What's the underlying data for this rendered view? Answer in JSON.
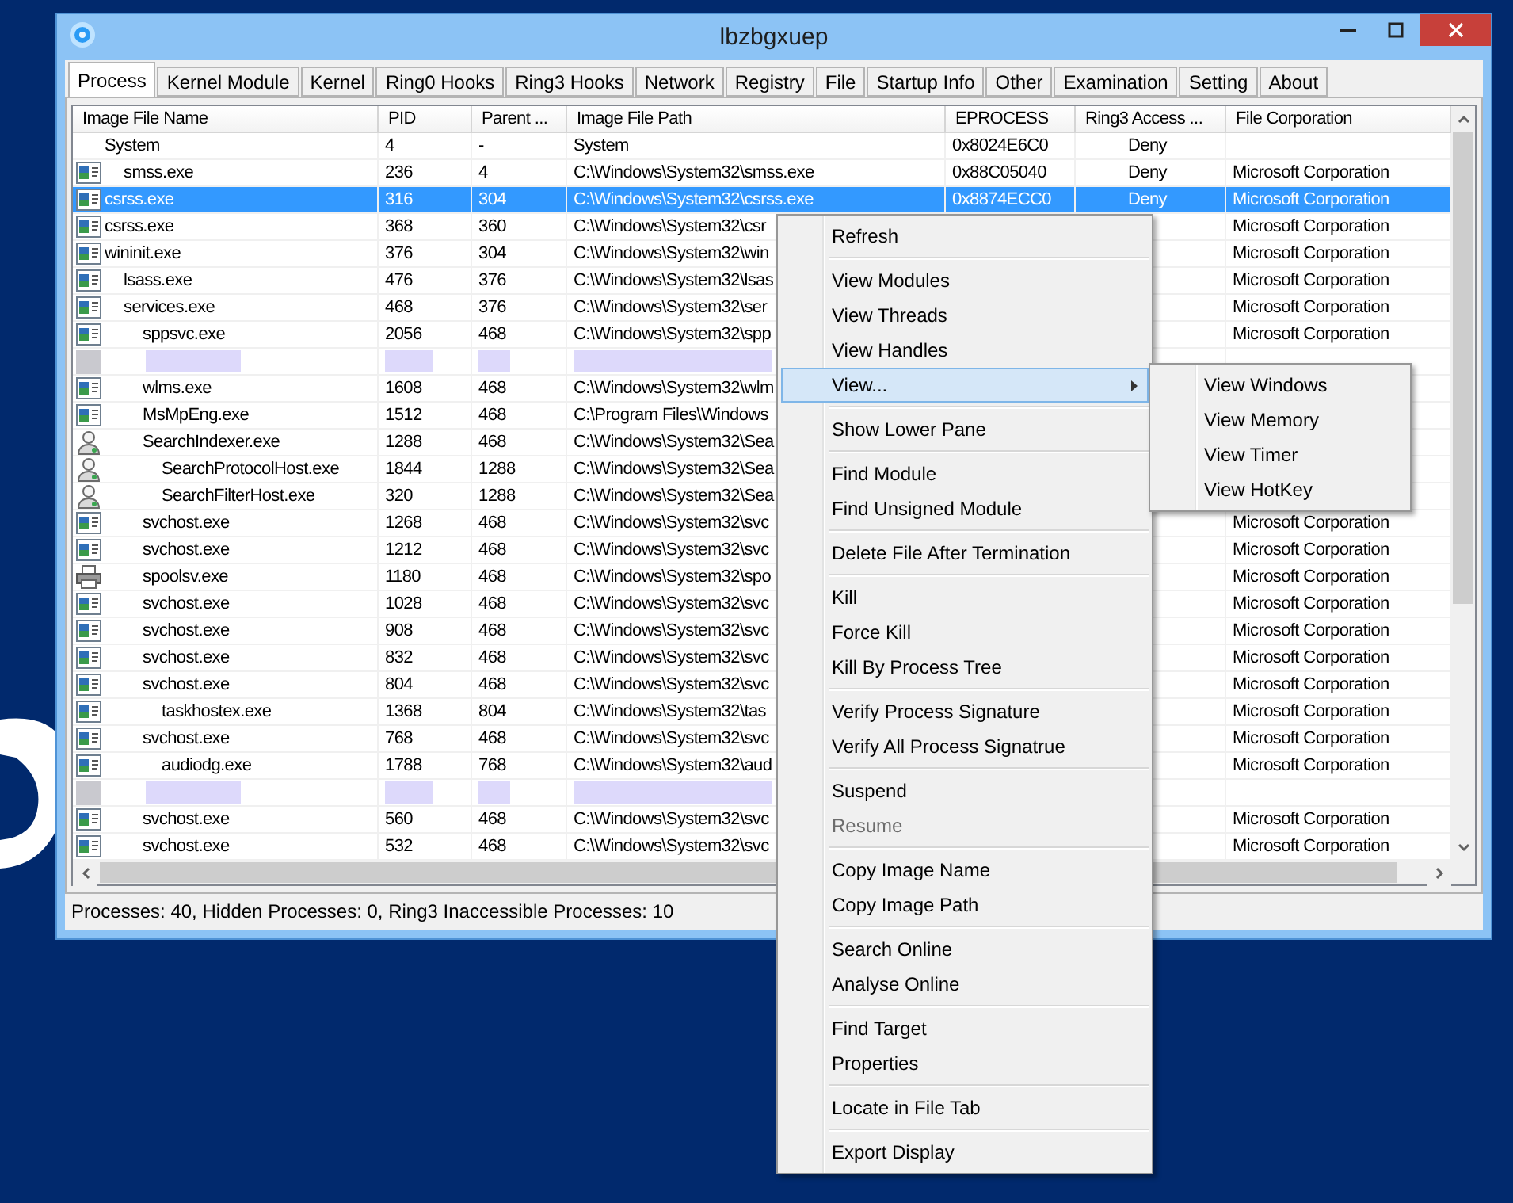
{
  "window": {
    "title": "lbzbgxuep"
  },
  "tabs": [
    {
      "label": "Process",
      "selected": true
    },
    {
      "label": "Kernel Module",
      "selected": false
    },
    {
      "label": "Kernel",
      "selected": false
    },
    {
      "label": "Ring0 Hooks",
      "selected": false
    },
    {
      "label": "Ring3 Hooks",
      "selected": false
    },
    {
      "label": "Network",
      "selected": false
    },
    {
      "label": "Registry",
      "selected": false
    },
    {
      "label": "File",
      "selected": false
    },
    {
      "label": "Startup Info",
      "selected": false
    },
    {
      "label": "Other",
      "selected": false
    },
    {
      "label": "Examination",
      "selected": false
    },
    {
      "label": "Setting",
      "selected": false
    },
    {
      "label": "About",
      "selected": false
    }
  ],
  "table": {
    "columns": [
      "Image File Name",
      "PID",
      "Parent ...",
      "Image File Path",
      "EPROCESS",
      "Ring3 Access ...",
      "File Corporation"
    ],
    "processes": [
      {
        "kind": "system",
        "name": "System",
        "pid": "4",
        "parent": "-",
        "path": "System",
        "eprocess": "0x8024E6C0",
        "access": "Deny",
        "selected": false,
        "children": [
          {
            "kind": "app",
            "name": "smss.exe",
            "pid": "236",
            "parent": "4",
            "path": "C:\\Windows\\System32\\smss.exe",
            "eprocess": "0x88C05040",
            "access": "Deny",
            "corp": "Microsoft Corporation",
            "selected": false
          }
        ]
      },
      {
        "kind": "app",
        "name": "csrss.exe",
        "pid": "316",
        "parent": "304",
        "path": "C:\\Windows\\System32\\csrss.exe",
        "eprocess": "0x8874ECC0",
        "access": "Deny",
        "corp": "Microsoft Corporation",
        "selected": true
      },
      {
        "kind": "app",
        "name": "csrss.exe",
        "pid": "368",
        "parent": "360",
        "path": "C:\\Windows\\System32\\csr",
        "corp": "Microsoft Corporation",
        "selected": false
      },
      {
        "kind": "app",
        "name": "wininit.exe",
        "pid": "376",
        "parent": "304",
        "path": "C:\\Windows\\System32\\win",
        "corp": "Microsoft Corporation",
        "selected": false,
        "children": [
          {
            "kind": "app",
            "name": "lsass.exe",
            "pid": "476",
            "parent": "376",
            "path": "C:\\Windows\\System32\\lsas",
            "corp": "Microsoft Corporation",
            "selected": false
          },
          {
            "kind": "app",
            "name": "services.exe",
            "pid": "468",
            "parent": "376",
            "path": "C:\\Windows\\System32\\ser",
            "corp": "Microsoft Corporation",
            "selected": false,
            "children": [
              {
                "kind": "app",
                "name": "sppsvc.exe",
                "pid": "2056",
                "parent": "468",
                "path": "C:\\Windows\\System32\\spp",
                "corp": "Microsoft Corporation",
                "selected": false
              },
              {
                "kind": "redacted",
                "selected": false
              },
              {
                "kind": "app",
                "name": "wlms.exe",
                "pid": "1608",
                "parent": "468",
                "path": "C:\\Windows\\System32\\wlm",
                "selected": false
              },
              {
                "kind": "app",
                "name": "MsMpEng.exe",
                "pid": "1512",
                "parent": "468",
                "path": "C:\\Program Files\\Windows",
                "selected": false
              },
              {
                "kind": "search",
                "name": "SearchIndexer.exe",
                "pid": "1288",
                "parent": "468",
                "path": "C:\\Windows\\System32\\Sea",
                "selected": false,
                "children": [
                  {
                    "kind": "search",
                    "name": "SearchProtocolHost.exe",
                    "pid": "1844",
                    "parent": "1288",
                    "path": "C:\\Windows\\System32\\Sea",
                    "selected": false
                  },
                  {
                    "kind": "search",
                    "name": "SearchFilterHost.exe",
                    "pid": "320",
                    "parent": "1288",
                    "path": "C:\\Windows\\System32\\Sea",
                    "selected": false
                  }
                ]
              },
              {
                "kind": "app",
                "name": "svchost.exe",
                "pid": "1268",
                "parent": "468",
                "path": "C:\\Windows\\System32\\svc",
                "corp": "Microsoft Corporation",
                "selected": false
              },
              {
                "kind": "app",
                "name": "svchost.exe",
                "pid": "1212",
                "parent": "468",
                "path": "C:\\Windows\\System32\\svc",
                "corp": "Microsoft Corporation",
                "selected": false
              },
              {
                "kind": "printer",
                "name": "spoolsv.exe",
                "pid": "1180",
                "parent": "468",
                "path": "C:\\Windows\\System32\\spo",
                "corp": "Microsoft Corporation",
                "selected": false
              },
              {
                "kind": "app",
                "name": "svchost.exe",
                "pid": "1028",
                "parent": "468",
                "path": "C:\\Windows\\System32\\svc",
                "corp": "Microsoft Corporation",
                "selected": false
              },
              {
                "kind": "app",
                "name": "svchost.exe",
                "pid": "908",
                "parent": "468",
                "path": "C:\\Windows\\System32\\svc",
                "corp": "Microsoft Corporation",
                "selected": false
              },
              {
                "kind": "app",
                "name": "svchost.exe",
                "pid": "832",
                "parent": "468",
                "path": "C:\\Windows\\System32\\svc",
                "corp": "Microsoft Corporation",
                "selected": false
              },
              {
                "kind": "app",
                "name": "svchost.exe",
                "pid": "804",
                "parent": "468",
                "path": "C:\\Windows\\System32\\svc",
                "corp": "Microsoft Corporation",
                "selected": false,
                "children": [
                  {
                    "kind": "app",
                    "name": "taskhostex.exe",
                    "pid": "1368",
                    "parent": "804",
                    "path": "C:\\Windows\\System32\\tas",
                    "corp": "Microsoft Corporation",
                    "selected": false
                  }
                ]
              },
              {
                "kind": "app",
                "name": "svchost.exe",
                "pid": "768",
                "parent": "468",
                "path": "C:\\Windows\\System32\\svc",
                "corp": "Microsoft Corporation",
                "selected": false,
                "children": [
                  {
                    "kind": "app",
                    "name": "audiodg.exe",
                    "pid": "1788",
                    "parent": "768",
                    "path": "C:\\Windows\\System32\\aud",
                    "corp": "Microsoft Corporation",
                    "selected": false
                  }
                ]
              },
              {
                "kind": "redacted",
                "selected": false
              },
              {
                "kind": "app",
                "name": "svchost.exe",
                "pid": "560",
                "parent": "468",
                "path": "C:\\Windows\\System32\\svc",
                "corp": "Microsoft Corporation",
                "selected": false
              },
              {
                "kind": "app",
                "name": "svchost.exe",
                "pid": "532",
                "parent": "468",
                "path": "C:\\Windows\\System32\\svc",
                "corp": "Microsoft Corporation",
                "selected": false
              }
            ]
          }
        ]
      }
    ]
  },
  "status_bar": "Processes: 40, Hidden Processes: 0, Ring3 Inaccessible Processes: 10",
  "context_menu": {
    "groups": [
      [
        {
          "label": "Refresh",
          "kind": "action",
          "selected": false,
          "disabled": false
        }
      ],
      [
        {
          "label": "View Modules",
          "kind": "action",
          "selected": false,
          "disabled": false
        },
        {
          "label": "View Threads",
          "kind": "action",
          "selected": false,
          "disabled": false
        },
        {
          "label": "View Handles",
          "kind": "action",
          "selected": false,
          "disabled": false
        },
        {
          "label": "View...",
          "kind": "submenu",
          "selected": true,
          "disabled": false
        }
      ],
      [
        {
          "label": "Show Lower Pane",
          "kind": "action",
          "selected": false,
          "disabled": false
        }
      ],
      [
        {
          "label": "Find Module",
          "kind": "action",
          "selected": false,
          "disabled": false
        },
        {
          "label": "Find Unsigned Module",
          "kind": "action",
          "selected": false,
          "disabled": false
        }
      ],
      [
        {
          "label": "Delete File After Termination",
          "kind": "action",
          "selected": false,
          "disabled": false
        }
      ],
      [
        {
          "label": "Kill",
          "kind": "action",
          "selected": false,
          "disabled": false
        },
        {
          "label": "Force Kill",
          "kind": "action",
          "selected": false,
          "disabled": false
        },
        {
          "label": "Kill By Process Tree",
          "kind": "action",
          "selected": false,
          "disabled": false
        }
      ],
      [
        {
          "label": "Verify Process Signature",
          "kind": "action",
          "selected": false,
          "disabled": false
        },
        {
          "label": "Verify All Process Signatrue",
          "kind": "action",
          "selected": false,
          "disabled": false
        }
      ],
      [
        {
          "label": "Suspend",
          "kind": "action",
          "selected": false,
          "disabled": false
        },
        {
          "label": "Resume",
          "kind": "action",
          "selected": false,
          "disabled": true
        }
      ],
      [
        {
          "label": "Copy Image Name",
          "kind": "action",
          "selected": false,
          "disabled": false
        },
        {
          "label": "Copy Image Path",
          "kind": "action",
          "selected": false,
          "disabled": false
        }
      ],
      [
        {
          "label": "Search Online",
          "kind": "action",
          "selected": false,
          "disabled": false
        },
        {
          "label": "Analyse Online",
          "kind": "action",
          "selected": false,
          "disabled": false
        }
      ],
      [
        {
          "label": "Find Target",
          "kind": "action",
          "selected": false,
          "disabled": false
        },
        {
          "label": "Properties",
          "kind": "action",
          "selected": false,
          "disabled": false
        }
      ],
      [
        {
          "label": "Locate in File Tab",
          "kind": "action",
          "selected": false,
          "disabled": false
        }
      ],
      [
        {
          "label": "Export Display",
          "kind": "action",
          "selected": false,
          "disabled": false
        }
      ]
    ]
  },
  "submenu": {
    "items": [
      {
        "label": "View Windows",
        "selected": false
      },
      {
        "label": "View Memory",
        "selected": false
      },
      {
        "label": "View Timer",
        "selected": false
      },
      {
        "label": "View HotKey",
        "selected": false
      }
    ]
  }
}
